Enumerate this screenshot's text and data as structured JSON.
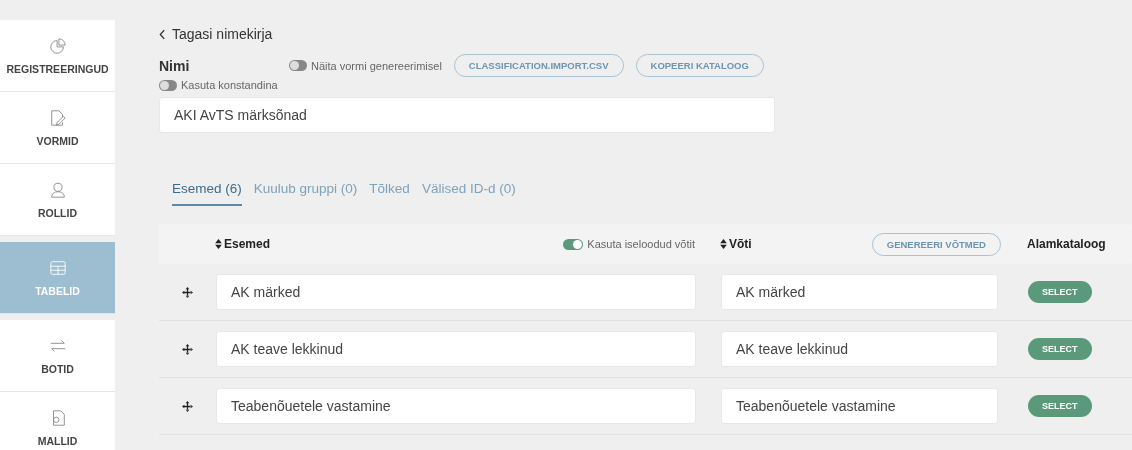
{
  "sidebar": {
    "items": [
      {
        "label": "REGISTREERINGUD",
        "kind": "pie",
        "selected": false
      },
      {
        "label": "VORMID",
        "kind": "form",
        "selected": false
      },
      {
        "label": "ROLLID",
        "kind": "user",
        "selected": false
      },
      {
        "label": "TABELID",
        "kind": "table",
        "selected": true
      },
      {
        "label": "BOTID",
        "kind": "arrows",
        "selected": false
      },
      {
        "label": "MALLID",
        "kind": "template",
        "selected": false
      }
    ]
  },
  "back_link": "Tagasi nimekirja",
  "name_section": {
    "label": "Nimi",
    "toggles": [
      {
        "label": "Näita vormi genereerimisel",
        "on": false
      },
      {
        "label": "Kasuta konstandina",
        "on": false
      }
    ],
    "buttons": [
      "CLASSIFICATION.IMPORT.CSV",
      "KOPEERI KATALOOG"
    ],
    "value": "AKI AvTS märksõnad"
  },
  "tabs": [
    {
      "label": "Esemed (6)",
      "selected": true
    },
    {
      "label": "Kuulub gruppi (0)",
      "selected": false
    },
    {
      "label": "Tõlked",
      "selected": false
    },
    {
      "label": "Välised ID-d (0)",
      "selected": false
    }
  ],
  "table": {
    "header": {
      "items_column": "Esemed",
      "custom_keys_toggle": {
        "label": "Kasuta iseloodud võtit",
        "on": true
      },
      "key_column": "Võti",
      "generate_button": "GENEREERI VÕTMED",
      "subcatalog_column": "Alamkataloog"
    },
    "rows": [
      {
        "item": "AK märked",
        "key": "AK märked",
        "action": "SELECT"
      },
      {
        "item": "AK teave lekkinud",
        "key": "AK teave lekkinud",
        "action": "SELECT"
      },
      {
        "item": "Teabenõuetele vastamine",
        "key": "Teabenõuetele vastamine",
        "action": "SELECT"
      }
    ]
  }
}
